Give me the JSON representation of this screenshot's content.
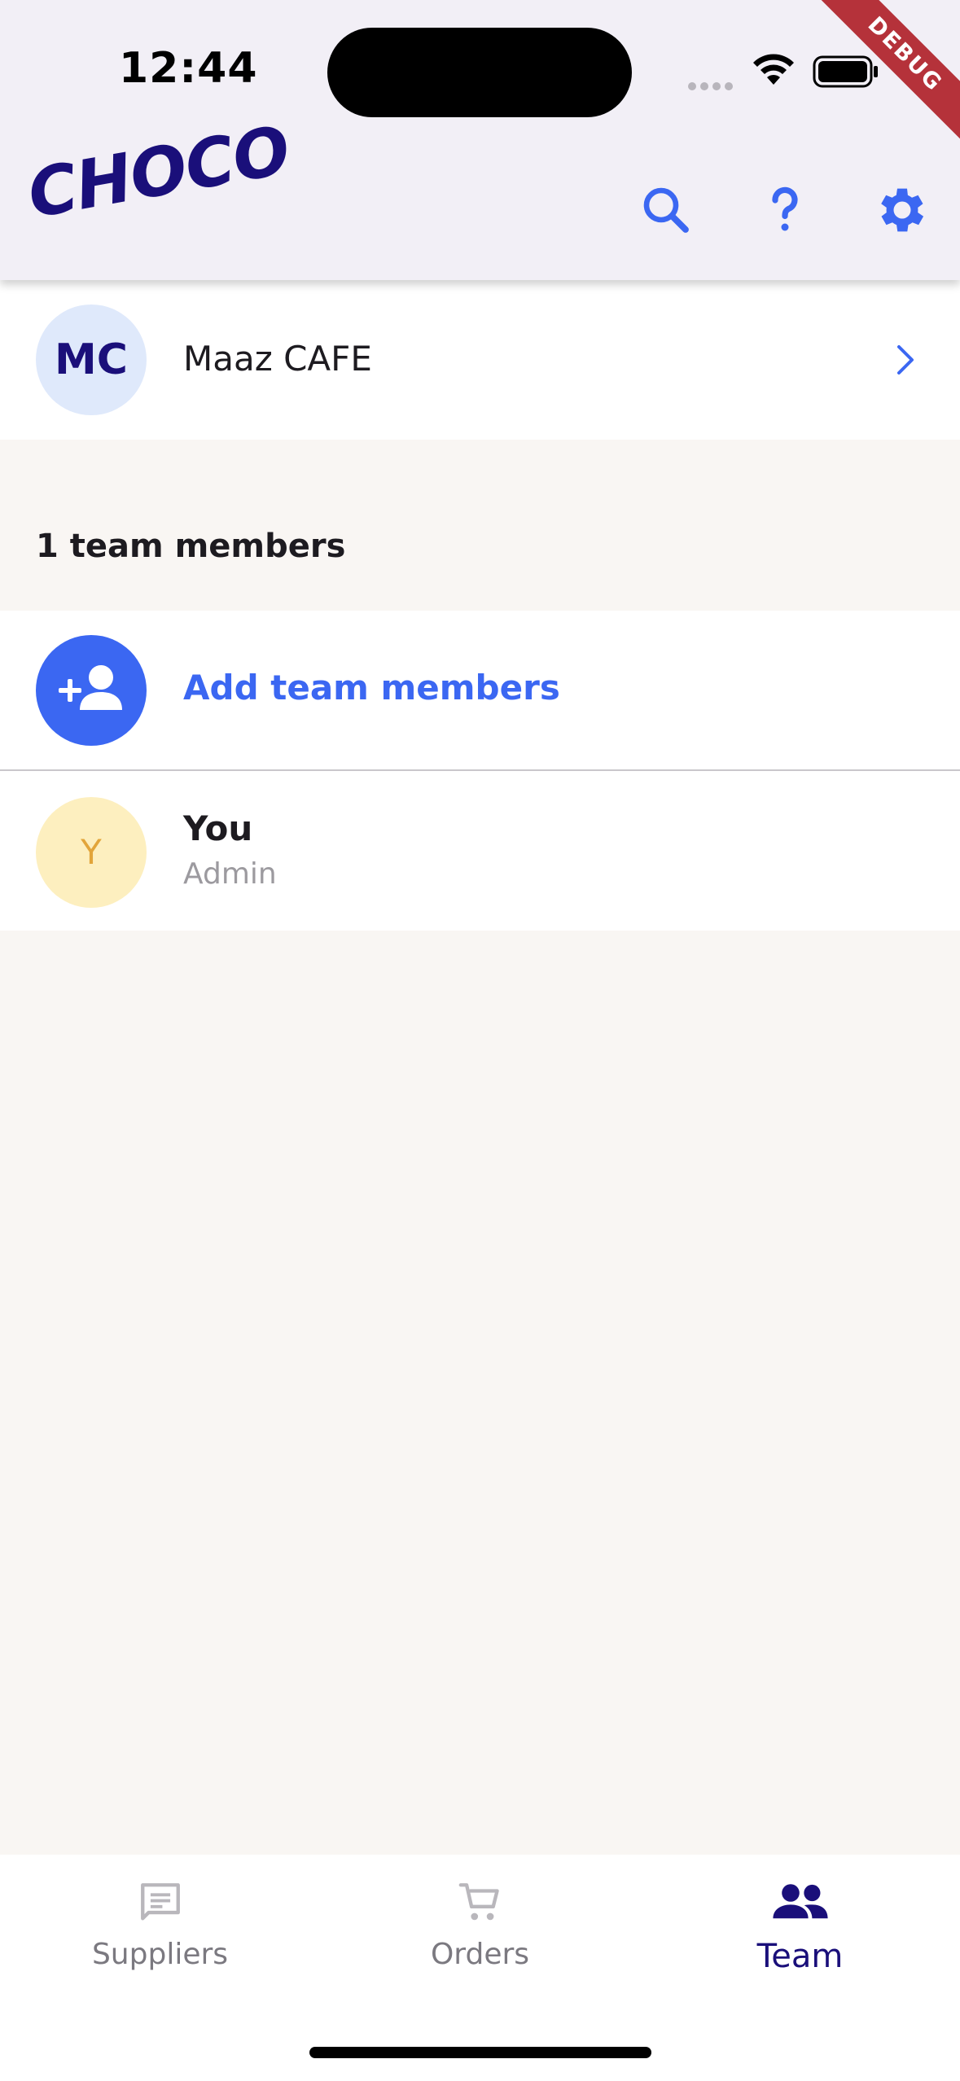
{
  "status_bar": {
    "time": "12:44"
  },
  "debug_banner": "DEBUG",
  "app_bar": {
    "logo_text": "CHOCO",
    "actions": [
      "search-icon",
      "help-icon",
      "settings-icon"
    ]
  },
  "colors": {
    "brand_navy": "#1a0f7a",
    "accent_blue": "#3b67f2",
    "app_bar_bg": "#f2eff6",
    "page_bg": "#f9f6f3",
    "avatar_mc_bg": "#dfe9fb",
    "avatar_you_bg": "#fdefbf"
  },
  "profile": {
    "initials": "MC",
    "name": "Maaz CAFE"
  },
  "team": {
    "count_label": "1 team members",
    "add_label": "Add team members",
    "members": [
      {
        "initial": "Y",
        "name": "You",
        "role": "Admin"
      }
    ]
  },
  "bottom_nav": {
    "items": [
      {
        "label": "Suppliers",
        "icon": "chat-list-icon",
        "active": false
      },
      {
        "label": "Orders",
        "icon": "cart-icon",
        "active": false
      },
      {
        "label": "Team",
        "icon": "people-icon",
        "active": true
      }
    ]
  }
}
